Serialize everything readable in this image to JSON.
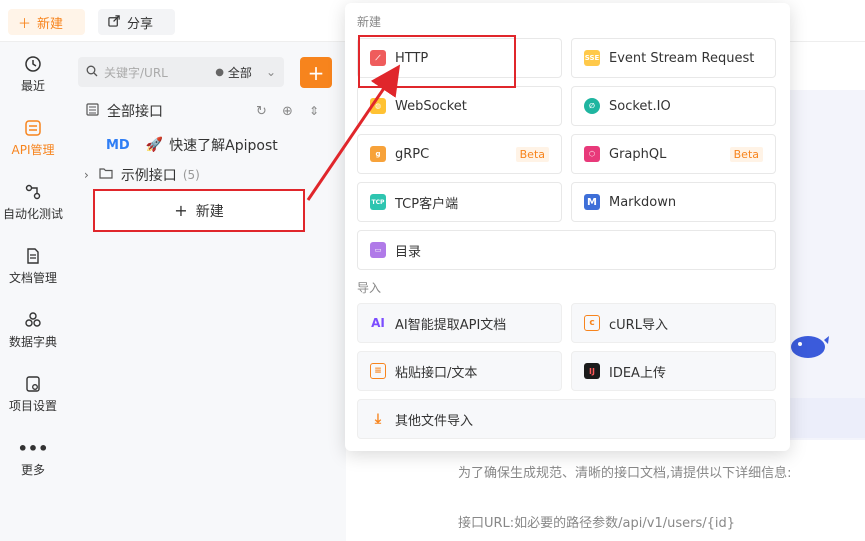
{
  "topbar": {
    "new_label": "新建",
    "share_label": "分享"
  },
  "nav": [
    {
      "label": "最近",
      "icon": "history-icon"
    },
    {
      "label": "API管理",
      "icon": "api-icon"
    },
    {
      "label": "自动化测试",
      "icon": "automation-icon"
    },
    {
      "label": "文档管理",
      "icon": "document-icon"
    },
    {
      "label": "数据字典",
      "icon": "dictionary-icon"
    },
    {
      "label": "项目设置",
      "icon": "settings-icon"
    },
    {
      "label": "更多",
      "icon": "more-icon"
    }
  ],
  "panel": {
    "search_placeholder": "关键字/URL",
    "filter_value": "全部",
    "all_label": "全部接口",
    "md_badge": "MD",
    "md_title": "快速了解Apipost",
    "folder_name": "示例接口",
    "folder_count": "(5)",
    "new_label": "新建"
  },
  "popup": {
    "new_section": "新建",
    "import_section": "导入",
    "new_items": [
      {
        "label": "HTTP",
        "icon": "http-icon",
        "badge": ""
      },
      {
        "label": "Event Stream Request",
        "icon": "sse-icon",
        "badge": "SSE"
      },
      {
        "label": "WebSocket",
        "icon": "websocket-icon",
        "badge": ""
      },
      {
        "label": "Socket.IO",
        "icon": "socketio-icon",
        "badge": ""
      },
      {
        "label": "gRPC",
        "icon": "grpc-icon",
        "badge": "Beta"
      },
      {
        "label": "GraphQL",
        "icon": "graphql-icon",
        "badge": "Beta"
      },
      {
        "label": "TCP客户端",
        "icon": "tcp-icon",
        "badge": "TCP"
      },
      {
        "label": "Markdown",
        "icon": "markdown-icon",
        "badge": "M"
      },
      {
        "label": "目录",
        "icon": "folder-icon",
        "badge": ""
      }
    ],
    "import_items": [
      {
        "label": "AI智能提取API文档",
        "icon": "ai-icon",
        "badge": "AI"
      },
      {
        "label": "cURL导入",
        "icon": "curl-icon",
        "badge": ""
      },
      {
        "label": "粘贴接口/文本",
        "icon": "paste-icon",
        "badge": ""
      },
      {
        "label": "IDEA上传",
        "icon": "idea-icon",
        "badge": "IJ"
      },
      {
        "label": "其他文件导入",
        "icon": "import-icon",
        "badge": ""
      }
    ]
  },
  "background": {
    "line1": "为了确保生成规范、清晰的接口文档,请提供以下详细信息:",
    "line2": "接口URL:如必要的路径参数/api/v1/users/{id}"
  },
  "colors": {
    "accent": "#f7841d",
    "highlight": "#e0262b"
  }
}
